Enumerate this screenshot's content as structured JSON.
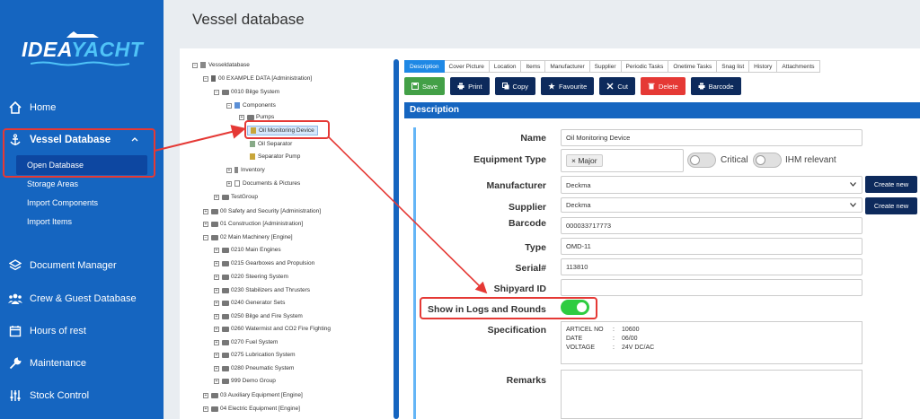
{
  "brand": {
    "part1": "IDEA",
    "part2": "YACHT"
  },
  "page_title": "Vessel database",
  "sidebar": {
    "items": [
      {
        "label": "Home",
        "icon": "home-icon"
      },
      {
        "label": "Vessel Database",
        "icon": "anchor-icon"
      },
      {
        "label": "Document Manager",
        "icon": "layers-icon"
      },
      {
        "label": "Crew & Guest Database",
        "icon": "users-icon"
      },
      {
        "label": "Hours of rest",
        "icon": "calendar-icon"
      },
      {
        "label": "Maintenance",
        "icon": "wrench-icon"
      },
      {
        "label": "Stock Control",
        "icon": "sliders-icon"
      }
    ],
    "subitems": [
      "Open Database",
      "Storage Areas",
      "Import Components",
      "Import Items"
    ]
  },
  "tree": [
    "Vesseldatabase",
    "00 EXAMPLE DATA [Administration]",
    "0010 Bilge System",
    "Components",
    "Pumps",
    "Oil Monitoring Device",
    "Oil Separator",
    "Separator Pump",
    "Inventory",
    "Documents & Pictures",
    "TestGroup",
    "00 Safety and Security [Administration]",
    "01 Construction [Administration]",
    "02 Main Machinery [Engine]",
    "0210 Main Engines",
    "0215 Gearboxes and Propulsion",
    "0220 Steering System",
    "0230 Stabilizers and Thrusters",
    "0240 Generator Sets",
    "0250 Bilge and Fire System",
    "0260 Watermist and CO2 Fire Fighting",
    "0270 Fuel System",
    "0275 Lubrication System",
    "0280 Pneumatic System",
    "999 Demo Group",
    "03 Auxiliary Equipment [Engine]",
    "04 Electric Equipment [Engine]"
  ],
  "tabs": [
    "Description",
    "Cover Picture",
    "Location",
    "Items",
    "Manufacturer",
    "Supplier",
    "Periodic Tasks",
    "Onetime Tasks",
    "Snag list",
    "History",
    "Attachments"
  ],
  "toolbar": {
    "save": "Save",
    "print": "Print",
    "copy": "Copy",
    "favourite": "Favourite",
    "cut": "Cut",
    "delete": "Delete",
    "barcode": "Barcode"
  },
  "description": {
    "header": "Description",
    "labels": {
      "name": "Name",
      "equipment_type": "Equipment Type",
      "manufacturer": "Manufacturer",
      "supplier": "Supplier",
      "barcode": "Barcode",
      "type": "Type",
      "serial": "Serial#",
      "shipyard_id": "Shipyard ID",
      "show_in_logs": "Show in Logs and Rounds",
      "specification": "Specification",
      "remarks": "Remarks"
    },
    "values": {
      "name": "Oil Monitoring Device",
      "equipment_type": "× Major",
      "manufacturer": "Deckma",
      "supplier": "Deckma",
      "barcode": "000033717773",
      "type": "OMD-11",
      "serial": "113810",
      "shipyard_id": ""
    },
    "critical_label": "Critical",
    "ihm_label": "IHM relevant",
    "critical_on": false,
    "ihm_on": false,
    "show_in_logs_on": true,
    "create_new": "Create new",
    "specification_rows": [
      {
        "key": "ARTICEL NO",
        "sep": ":",
        "value": "10600"
      },
      {
        "key": "DATE",
        "sep": ":",
        "value": "06/00"
      },
      {
        "key": "VOLTAGE",
        "sep": ":",
        "value": "24V DC/AC"
      }
    ]
  },
  "colors": {
    "sidebar": "#1565c0",
    "accent": "#1e88e5",
    "highlight": "#e53935",
    "toggle_on": "#2ecc40",
    "dark_button": "#0d2a5c"
  }
}
